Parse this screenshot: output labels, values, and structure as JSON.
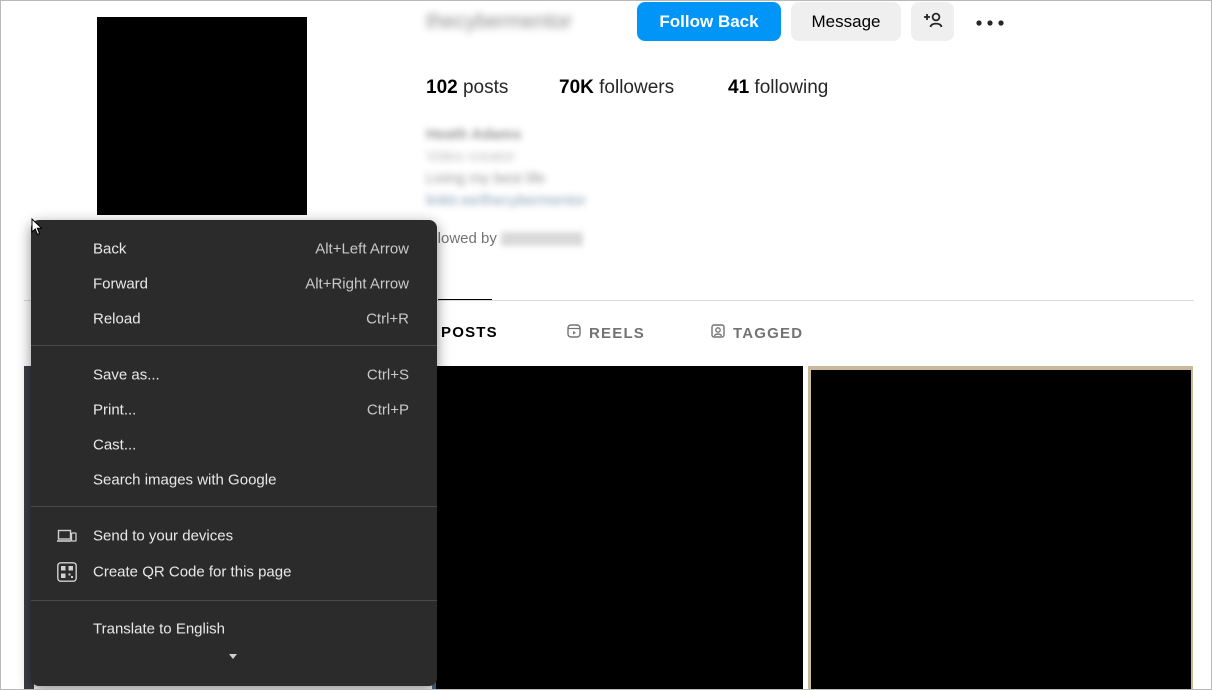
{
  "profile": {
    "username": "thecybermentor",
    "follow_back_label": "Follow Back",
    "message_label": "Message",
    "add_user_icon": "add-user-icon",
    "more_icon": "more-horizontal-icon"
  },
  "stats": {
    "posts_count": "102",
    "posts_label": "posts",
    "followers_count": "70K",
    "followers_label": "followers",
    "following_count": "41",
    "following_label": "following"
  },
  "bio": {
    "name": "Heath Adams",
    "category": "Video creator",
    "line": "Living my best life",
    "link": "linktr.ee/thecybermentor"
  },
  "followed_by": {
    "prefix": "ollowed by",
    "who": "aldo.secon"
  },
  "tabs": [
    {
      "label": "POSTS",
      "icon": "grid-icon",
      "active": true
    },
    {
      "label": "REELS",
      "icon": "reels-icon",
      "active": false
    },
    {
      "label": "TAGGED",
      "icon": "tagged-icon",
      "active": false
    }
  ],
  "context_menu": {
    "items": [
      {
        "label": "Back",
        "shortcut": "Alt+Left Arrow"
      },
      {
        "label": "Forward",
        "shortcut": "Alt+Right Arrow"
      },
      {
        "label": "Reload",
        "shortcut": "Ctrl+R"
      },
      {
        "label": "Save as...",
        "shortcut": "Ctrl+S"
      },
      {
        "label": "Print...",
        "shortcut": "Ctrl+P"
      },
      {
        "label": "Cast...",
        "shortcut": ""
      },
      {
        "label": "Search images with Google",
        "shortcut": ""
      },
      {
        "label": "Send to your devices",
        "shortcut": "",
        "icon": "devices-icon"
      },
      {
        "label": "Create QR Code for this page",
        "shortcut": "",
        "icon": "qr-code-icon"
      },
      {
        "label": "Translate to English",
        "shortcut": ""
      }
    ],
    "more_icon": "chevron-down-icon"
  },
  "colors": {
    "accent": "#0095f6",
    "menu_bg": "#2b2b2b",
    "menu_text": "#e8e8e8"
  }
}
